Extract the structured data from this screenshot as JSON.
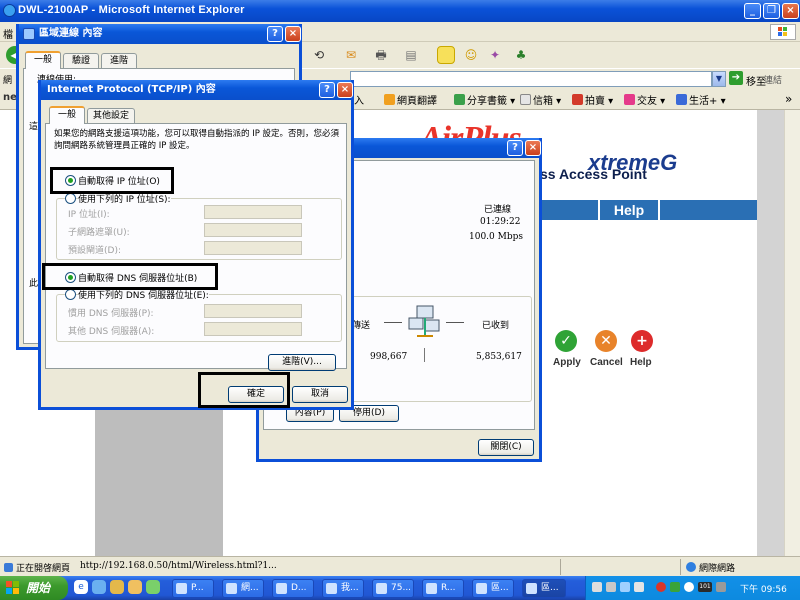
{
  "ie": {
    "title": "DWL-2100AP - Microsoft Internet Explorer",
    "menu_fragment": "檔",
    "address_fragment": "網",
    "go_label": "移至",
    "links_extra": "連結",
    "brand_fragment": "ne",
    "links": [
      {
        "label": "入"
      },
      {
        "label": "網頁翻譯"
      },
      {
        "label": "分享書籤"
      },
      {
        "label": "信箱"
      },
      {
        "label": "拍賣"
      },
      {
        "label": "交友"
      },
      {
        "label": "生活+"
      }
    ],
    "status_text": "正在開啓網頁",
    "status_url": "http://192.168.0.50/html/Wireless.html?1...",
    "zone": "網際網路"
  },
  "dlink": {
    "brand": "AirPlus",
    "brand2": "xtremeG",
    "product": "ss Access Point",
    "nav": {
      "status": "tus",
      "help": "Help"
    },
    "actions": [
      {
        "label": "Apply",
        "icon": "check-icon",
        "color": "#2fa336"
      },
      {
        "label": "Cancel",
        "icon": "cancel-icon",
        "color": "#e8832a"
      },
      {
        "label": "Help",
        "icon": "help-icon",
        "color": "#dd2b2b"
      }
    ]
  },
  "lan_props": {
    "title": "區域連線 內容",
    "tabs": [
      "一般",
      "驗證",
      "進階"
    ],
    "connect_using": "連線使用:",
    "frag_a": "這",
    "frag_b": "此"
  },
  "tcpip": {
    "title": "Internet Protocol (TCP/IP) 內容",
    "tabs": [
      "一般",
      "其他設定"
    ],
    "description": "如果您的網路支援這項功能，您可以取得自動指派的 IP 設定。否則，您必須詢問網路系統管理員正確的 IP 設定。",
    "auto_ip": "自動取得 IP 位址(O)",
    "manual_ip": "使用下列的 IP 位址(S):",
    "ip_label": "IP 位址(I):",
    "mask_label": "子網路遮罩(U):",
    "gateway_label": "預設閘道(D):",
    "auto_dns": "自動取得 DNS 伺服器位址(B)",
    "manual_dns": "使用下列的 DNS 伺服器位址(E):",
    "preferred_dns": "慣用 DNS 伺服器(P):",
    "alternate_dns": "其他 DNS 伺服器(A):",
    "advanced_button": "進階(V)...",
    "ok_button": "確定",
    "cancel_button": "取消",
    "auto_ip_selected": true,
    "auto_dns_selected": true
  },
  "status_dialog": {
    "state": "已連線",
    "duration": "01:29:22",
    "speed": "100.0 Mbps",
    "sent_label": "已傳送",
    "received_label": "已收到",
    "sent_value": "998,667",
    "received_value": "5,853,617",
    "properties_button": "內容(P)",
    "disable_button": "停用(D)",
    "close_button": "關閉(C)"
  },
  "taskbar": {
    "start_label": "開始",
    "items": [
      "P...",
      "網...",
      "D...",
      "我...",
      "75...",
      "R...",
      "區...",
      "區..."
    ],
    "clock": "下午 09:56",
    "tray_text": "101"
  }
}
